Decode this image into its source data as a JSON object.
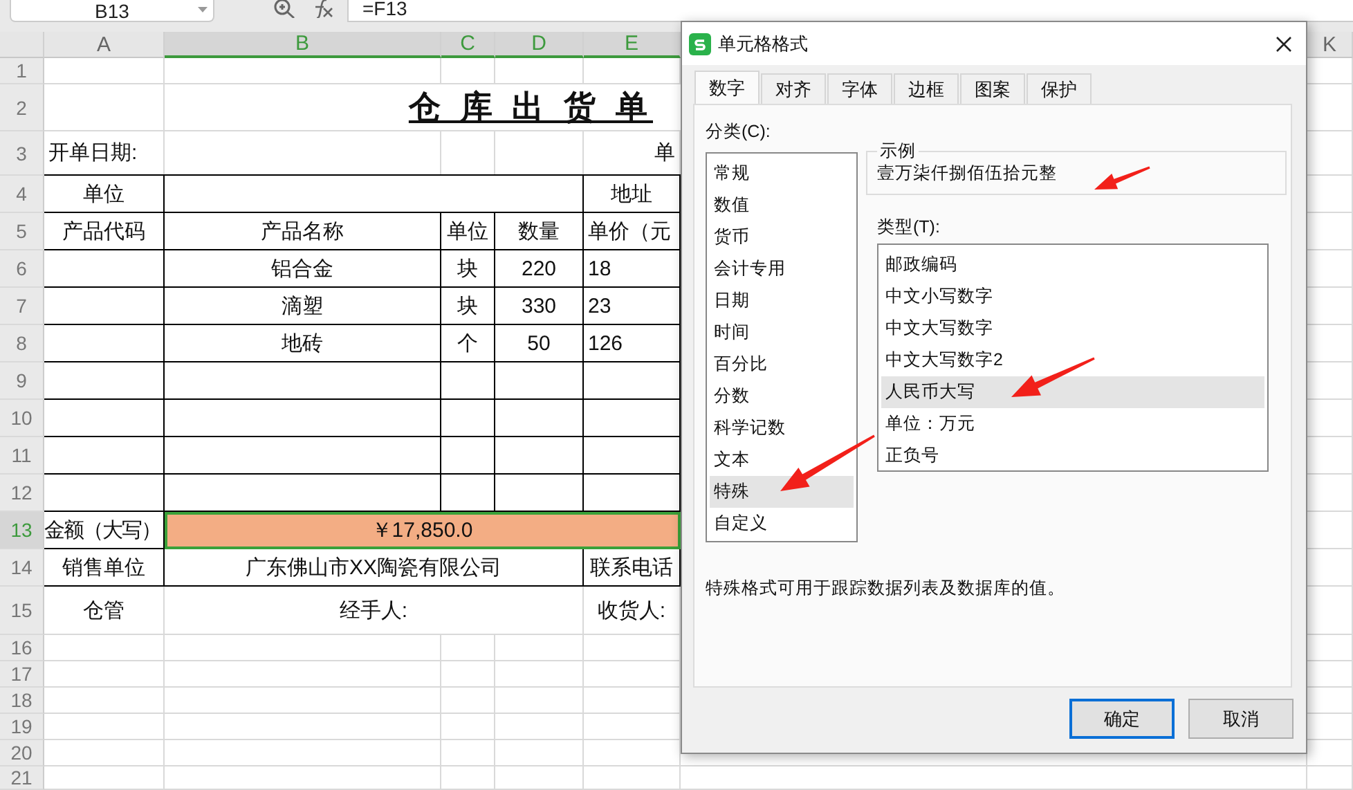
{
  "formula_bar": {
    "name_box": "B13",
    "formula": "=F13"
  },
  "sheet": {
    "columns": [
      {
        "label": "A",
        "selected": false
      },
      {
        "label": "B",
        "selected": true
      },
      {
        "label": "C",
        "selected": true
      },
      {
        "label": "D",
        "selected": true
      },
      {
        "label": "E",
        "selected": true
      },
      {
        "label": "K",
        "selected": false
      }
    ],
    "rows": [
      {
        "number": "1",
        "selected": false,
        "kind": "plain",
        "cells": {}
      },
      {
        "number": "2",
        "selected": false,
        "kind": "title",
        "cells": {
          "title": "仓 库 出 货 单"
        }
      },
      {
        "number": "3",
        "selected": false,
        "kind": "plain",
        "cells": {
          "a": "开单日期:",
          "e": "单"
        }
      },
      {
        "number": "4",
        "selected": false,
        "kind": "form",
        "cells": {
          "a": "单位",
          "e": "地址"
        }
      },
      {
        "number": "5",
        "selected": false,
        "kind": "item",
        "cells": {
          "a": "产品代码",
          "b": "产品名称",
          "c": "单位",
          "d": "数量",
          "e": "单价（元"
        }
      },
      {
        "number": "6",
        "selected": false,
        "kind": "item",
        "cells": {
          "b": "铝合金",
          "c": "块",
          "d": "220",
          "e": "18"
        }
      },
      {
        "number": "7",
        "selected": false,
        "kind": "item",
        "cells": {
          "b": "滴塑",
          "c": "块",
          "d": "330",
          "e": "23"
        }
      },
      {
        "number": "8",
        "selected": false,
        "kind": "item",
        "cells": {
          "b": "地砖",
          "c": "个",
          "d": "50",
          "e": "126"
        }
      },
      {
        "number": "9",
        "selected": false,
        "kind": "item",
        "cells": {}
      },
      {
        "number": "10",
        "selected": false,
        "kind": "item",
        "cells": {}
      },
      {
        "number": "11",
        "selected": false,
        "kind": "item",
        "cells": {}
      },
      {
        "number": "12",
        "selected": false,
        "kind": "item",
        "cells": {}
      },
      {
        "number": "13",
        "selected": true,
        "kind": "total",
        "cells": {
          "a": "金额（大写）",
          "amount": "￥17,850.0"
        }
      },
      {
        "number": "14",
        "selected": false,
        "kind": "form",
        "cells": {
          "a": "销售单位",
          "bd": "广东佛山市XX陶瓷有限公司",
          "e": "联系电话"
        }
      },
      {
        "number": "15",
        "selected": false,
        "kind": "signature",
        "cells": {
          "a": "仓管",
          "bd": "经手人:",
          "e": "收货人:"
        }
      },
      {
        "number": "16",
        "selected": false,
        "kind": "plain",
        "cells": {}
      },
      {
        "number": "17",
        "selected": false,
        "kind": "plain",
        "cells": {}
      },
      {
        "number": "18",
        "selected": false,
        "kind": "plain",
        "cells": {}
      },
      {
        "number": "19",
        "selected": false,
        "kind": "plain",
        "cells": {}
      },
      {
        "number": "20",
        "selected": false,
        "kind": "plain",
        "cells": {}
      },
      {
        "number": "21",
        "selected": false,
        "kind": "plain",
        "cells": {}
      }
    ]
  },
  "dialog": {
    "title": "单元格格式",
    "tabs": [
      {
        "label": "数字",
        "selected": true
      },
      {
        "label": "对齐",
        "selected": false
      },
      {
        "label": "字体",
        "selected": false
      },
      {
        "label": "边框",
        "selected": false
      },
      {
        "label": "图案",
        "selected": false
      },
      {
        "label": "保护",
        "selected": false
      }
    ],
    "category_label": "分类(C):",
    "categories": [
      {
        "label": "常规",
        "selected": false,
        "arrow": false
      },
      {
        "label": "数值",
        "selected": false,
        "arrow": false
      },
      {
        "label": "货币",
        "selected": false,
        "arrow": false
      },
      {
        "label": "会计专用",
        "selected": false,
        "arrow": false
      },
      {
        "label": "日期",
        "selected": false,
        "arrow": false
      },
      {
        "label": "时间",
        "selected": false,
        "arrow": false
      },
      {
        "label": "百分比",
        "selected": false,
        "arrow": false
      },
      {
        "label": "分数",
        "selected": false,
        "arrow": false
      },
      {
        "label": "科学记数",
        "selected": false,
        "arrow": false
      },
      {
        "label": "文本",
        "selected": false,
        "arrow": false
      },
      {
        "label": "特殊",
        "selected": true,
        "arrow": true
      },
      {
        "label": "自定义",
        "selected": false,
        "arrow": false
      }
    ],
    "sample": {
      "legend": "示例",
      "value": "壹万柒仟捌佰伍拾元整",
      "arrow": true
    },
    "type_label": "类型(T):",
    "types": [
      {
        "label": "邮政编码",
        "selected": false,
        "arrow": false
      },
      {
        "label": "中文小写数字",
        "selected": false,
        "arrow": false
      },
      {
        "label": "中文大写数字",
        "selected": false,
        "arrow": false
      },
      {
        "label": "中文大写数字2",
        "selected": false,
        "arrow": false
      },
      {
        "label": "人民币大写",
        "selected": true,
        "arrow": true
      },
      {
        "label": "单位：万元",
        "selected": false,
        "arrow": false
      },
      {
        "label": "正负号",
        "selected": false,
        "arrow": false
      }
    ],
    "description": "特殊格式可用于跟踪数据列表及数据库的值。",
    "buttons": [
      {
        "label": "确定",
        "default": true
      },
      {
        "label": "取消",
        "default": false
      }
    ]
  }
}
